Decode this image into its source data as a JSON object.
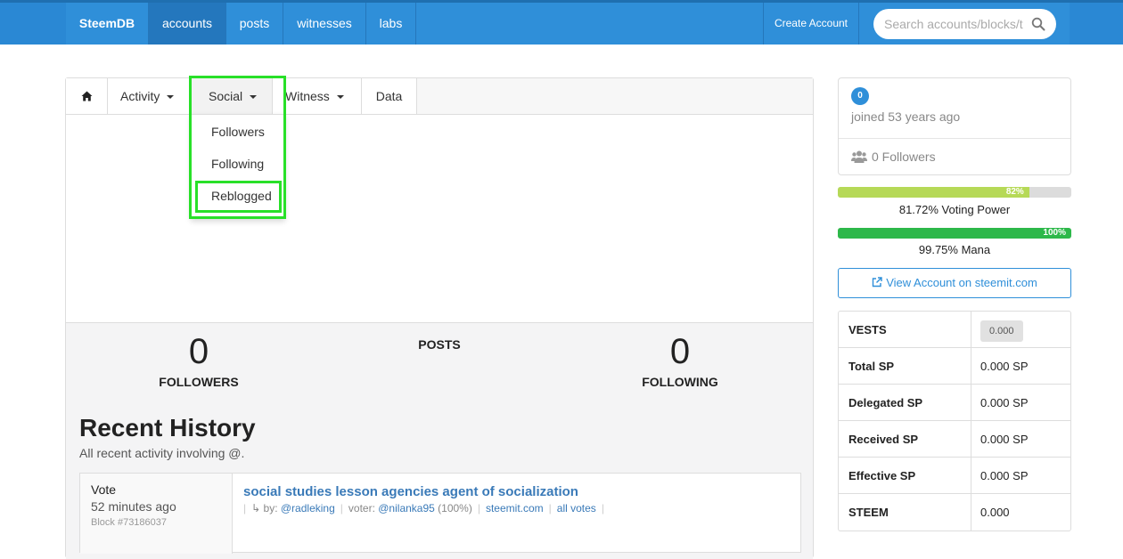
{
  "navbar": {
    "brand": "SteemDB",
    "items": [
      "accounts",
      "posts",
      "witnesses",
      "labs"
    ],
    "create_account": "Create Account",
    "search_placeholder": "Search accounts/blocks/t"
  },
  "tabs": {
    "activity": "Activity",
    "social": "Social",
    "witness": "Witness",
    "data": "Data"
  },
  "social_menu": [
    "Followers",
    "Following",
    "Reblogged"
  ],
  "stats": {
    "followers_count": "0",
    "followers_label": "FOLLOWERS",
    "posts_label": "POSTS",
    "following_count": "0",
    "following_label": "FOLLOWING"
  },
  "recent_history": {
    "title": "Recent History",
    "subtitle": "All recent activity involving @.",
    "rows": [
      {
        "type": "Vote",
        "time": "52 minutes ago",
        "block": "Block #73186037",
        "title": "social studies lesson agencies agent of socialization",
        "by_prefix": "↳ by:",
        "author": "@radleking",
        "voter_prefix": "voter:",
        "voter": "@nilanka95",
        "weight": "(100%)",
        "link1": "steemit.com",
        "link2": "all votes"
      }
    ]
  },
  "profile": {
    "reputation": "0",
    "joined": "joined 53 years ago",
    "followers": "0 Followers"
  },
  "voting_power": {
    "percent": 82,
    "label": "82%",
    "caption": "81.72% Voting Power",
    "color": "#b6d957"
  },
  "mana": {
    "percent": 100,
    "label": "100%",
    "caption": "99.75% Mana",
    "color": "#2db84a"
  },
  "view_account": "View Account on steemit.com",
  "sp_table": [
    {
      "key": "VESTS",
      "value": "0.000"
    },
    {
      "key": "Total SP",
      "value": "0.000 SP"
    },
    {
      "key": "Delegated SP",
      "value": "0.000 SP"
    },
    {
      "key": "Received SP",
      "value": "0.000 SP"
    },
    {
      "key": "Effective SP",
      "value": "0.000 SP"
    },
    {
      "key": "STEEM",
      "value": "0.000"
    }
  ]
}
